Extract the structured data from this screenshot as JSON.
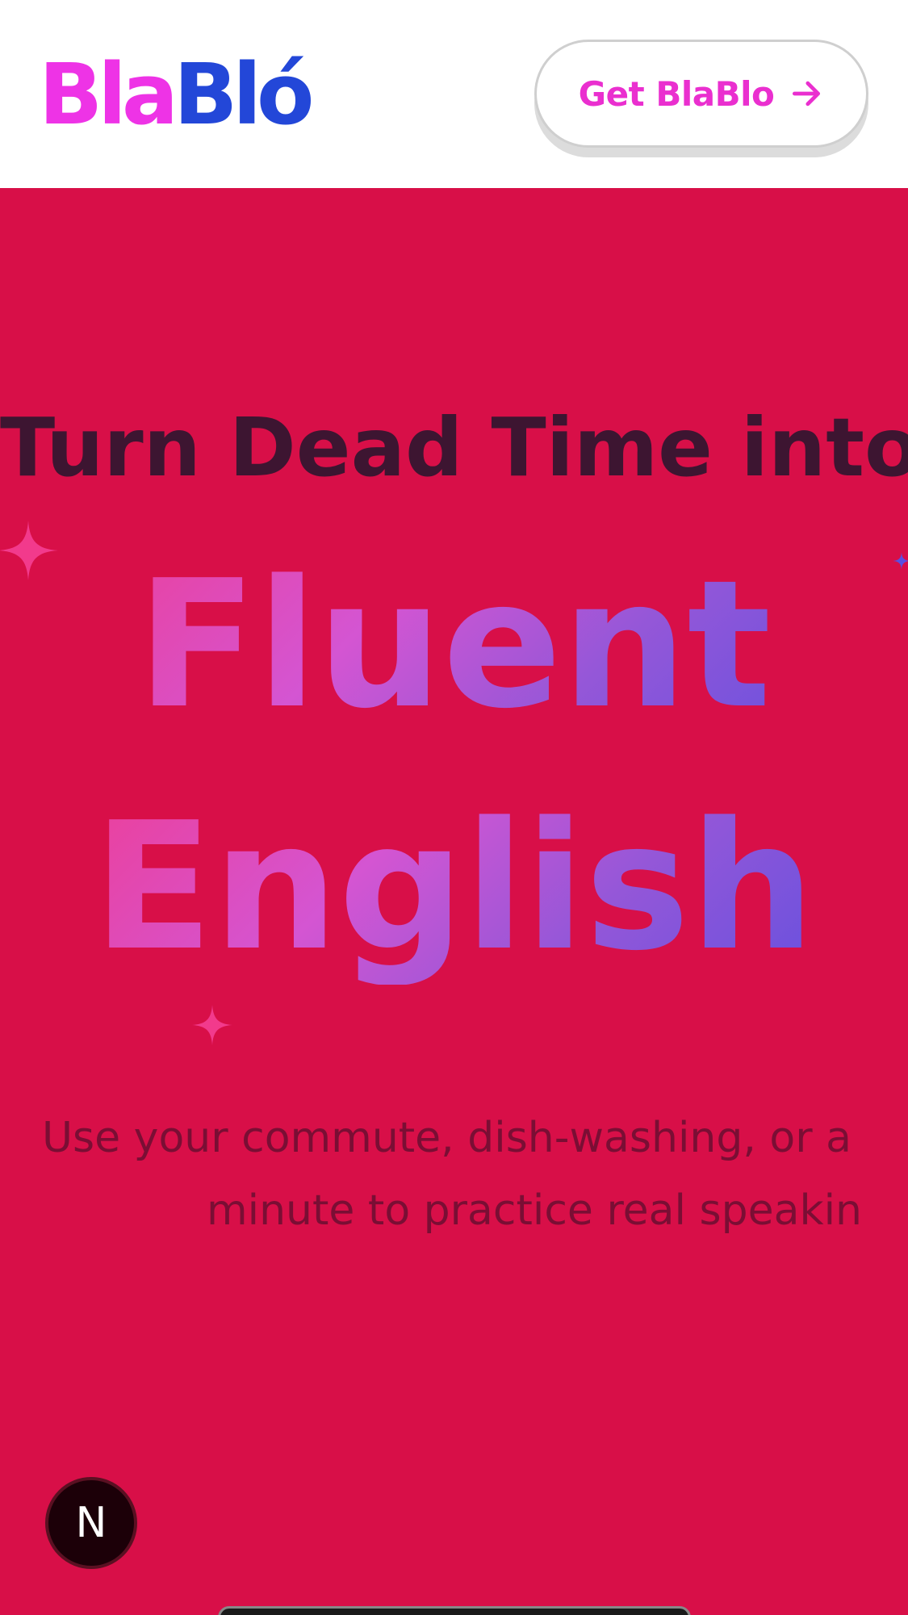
{
  "header": {
    "logo_part1": "Bla",
    "logo_part2": "Bló",
    "cta_label": "Get BlaBlo"
  },
  "hero": {
    "line1": "Turn Dead Time into",
    "line2": "Fluent",
    "line3": "English",
    "subtitle_line1": "Use your commute, dish-washing, or a",
    "subtitle_line2": "minute to practice real speakin"
  },
  "dev_badge": {
    "label": "N"
  },
  "colors": {
    "background": "#d80f48",
    "logo_pink": "#ee33e6",
    "logo_blue": "#2347d8",
    "cta_text": "#ea2fcf",
    "heading_dark": "#3d1531",
    "gradient_start": "#f23a8c",
    "gradient_end": "#5a4fe0"
  },
  "icons": {
    "cta_icon": "arrow-right-icon",
    "decorations": [
      "sparkle-icon",
      "sparkle-icon",
      "sparkle-icon"
    ]
  }
}
